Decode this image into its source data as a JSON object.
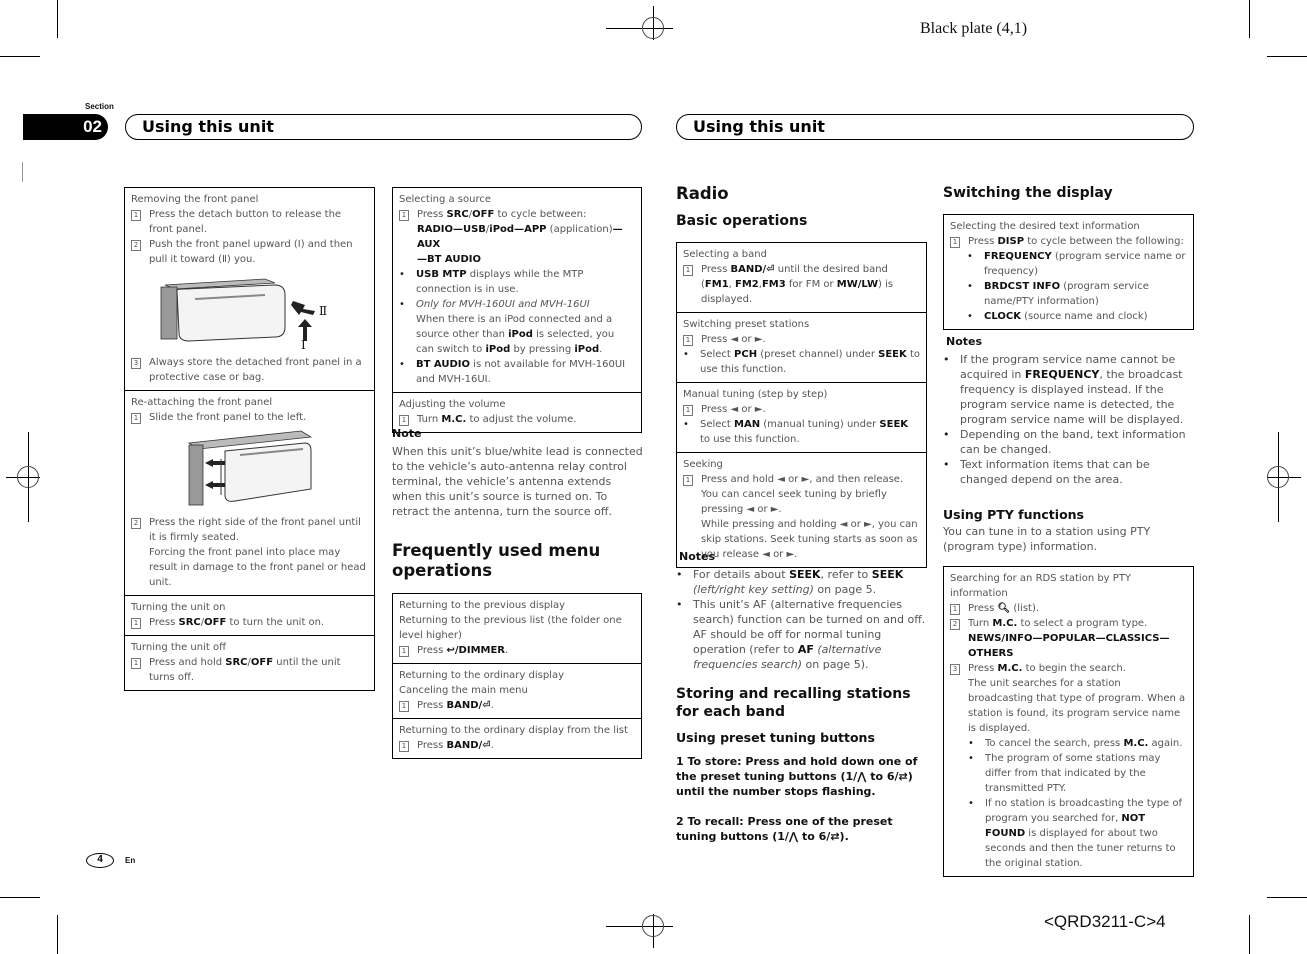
{
  "print_marks": {
    "plate_label": "Black plate (4,1)",
    "doc_code": "<QRD3211-C>4"
  },
  "header": {
    "section_label": "Section",
    "section_number": "02",
    "left_chapter_title": "Using this unit",
    "right_chapter_title": "Using this unit"
  },
  "footer": {
    "page_number": "4",
    "language": "En"
  },
  "col1": {
    "removing": {
      "title": "Removing the front panel",
      "step1": "Press the detach button to release the front panel.",
      "step2": "Push the front panel upward (Ⅰ) and then pull it toward (Ⅱ) you.",
      "step3": "Always store the detached front panel in a protective case or bag.",
      "illus_label_1": "Ⅰ",
      "illus_label_2": "Ⅱ"
    },
    "reattaching": {
      "title": "Re-attaching the front panel",
      "step1": "Slide the front panel to the left.",
      "step2": "Press the right side of the front panel until it is firmly seated.",
      "step2_note": "Forcing the front panel into place may result in damage to the front panel or head unit."
    },
    "turn_on": {
      "title": "Turning the unit on",
      "pre": "Press ",
      "key": "SRC",
      "sep": "/",
      "key2": "OFF",
      "post": " to turn the unit on."
    },
    "turn_off": {
      "title": "Turning the unit off",
      "pre": "Press and hold ",
      "key": "SRC",
      "sep": "/",
      "key2": "OFF",
      "post": " until the unit turns off."
    }
  },
  "col2": {
    "source": {
      "title": "Selecting a source",
      "step_pre": "Press ",
      "step_key": "SRC",
      "step_sep": "/",
      "step_key2": "OFF",
      "step_post": " to cycle between:",
      "cycle_radio": "RADIO",
      "cycle_usb": "USB",
      "cycle_ipod": "iPod",
      "cycle_app": "APP",
      "cycle_app_note": " (application)",
      "cycle_aux": "AUX",
      "cycle_bt": "BT AUDIO",
      "bullet1_key": "USB MTP",
      "bullet1_text": " displays while the MTP connection is in use.",
      "bullet2_italic": "Only for MVH-160UI and MVH-16UI",
      "bullet2_a": "When there is an iPod connected and a source other than ",
      "bullet2_key1": "iPod",
      "bullet2_b": " is selected, you can switch to ",
      "bullet2_key2": "iPod",
      "bullet2_c": " by pressing ",
      "bullet2_key3": "iPod",
      "bullet2_d": ".",
      "bullet3_key": "BT AUDIO",
      "bullet3_text": " is not available for MVH-160UI and MVH-16UI."
    },
    "volume": {
      "title": "Adjusting the volume",
      "pre": "Turn ",
      "key": "M.C.",
      "post": " to adjust the volume."
    },
    "note": {
      "title": "Note",
      "text": "When this unit’s blue/white lead is connected to the vehicle’s auto-antenna relay control terminal, the vehicle’s antenna extends when this unit’s source is turned on. To retract the antenna, turn the source off."
    },
    "menu_heading": "Frequently used menu operations",
    "prev_display": {
      "title": "Returning to the previous display",
      "subtitle": "Returning to the previous list (the folder one level higher)",
      "pre": "Press ",
      "icon": "↩",
      "key": "/DIMMER",
      "post": "."
    },
    "ordinary": {
      "title": "Returning to the ordinary display",
      "subtitle": "Canceling the main menu",
      "pre": "Press ",
      "key": "BAND/",
      "icon": "⏎",
      "post": "."
    },
    "ordinary_list": {
      "title": "Returning to the ordinary display from the list",
      "pre": "Press ",
      "key": "BAND/",
      "icon": "⏎",
      "post": "."
    }
  },
  "col3": {
    "radio_heading": "Radio",
    "basic_heading": "Basic operations",
    "band": {
      "title": "Selecting a band",
      "pre": "Press ",
      "key": "BAND/",
      "icon": "⏎",
      "mid": " until the desired band (",
      "fm1": "FM1",
      "c1": ", ",
      "fm2": "FM2",
      "c2": ",",
      "fm3": "FM3",
      "mid2": " for FM or ",
      "mwlw": "MW/LW",
      "post": ") is displayed."
    },
    "preset": {
      "title": "Switching preset stations",
      "step": "Press ◄ or ►.",
      "b_pre": "Select ",
      "b_key": "PCH",
      "b_mid": " (preset channel) under ",
      "b_key2": "SEEK",
      "b_post": " to use this function."
    },
    "manual": {
      "title": "Manual tuning (step by step)",
      "step": "Press ◄ or ►.",
      "b_pre": "Select ",
      "b_key": "MAN",
      "b_mid": " (manual tuning) under ",
      "b_key2": "SEEK",
      "b_post": " to use this function."
    },
    "seeking": {
      "title": "Seeking",
      "step": "Press and hold ◄ or ►, and then release.",
      "line2": "You can cancel seek tuning by briefly pressing ◄ or ►.",
      "line3": "While pressing and holding ◄ or ►, you can skip stations. Seek tuning starts as soon as you release ◄ or ►."
    },
    "notes": {
      "title": "Notes",
      "n1_pre": "For details about ",
      "n1_key": "SEEK",
      "n1_mid": ", refer to ",
      "n1_key2": "SEEK",
      "n1_italic": " (left/right key setting)",
      "n1_post": " on page 5.",
      "n2_pre": "This unit’s AF (alternative frequencies search) function can be turned on and off. AF should be off for normal tuning operation (refer to ",
      "n2_key": "AF",
      "n2_italic": " (alternative frequencies search)",
      "n2_post": " on page 5)."
    },
    "storing_heading": "Storing and recalling stations for each band",
    "preset_heading": "Using preset tuning buttons",
    "step1": "1    To store: Press and hold down one of the preset tuning buttons (1/⋀ to 6/⇄) until the number stops flashing.",
    "step2": "2    To recall: Press one of the preset tuning buttons (1/⋀ to 6/⇄)."
  },
  "col4": {
    "display_heading": "Switching the display",
    "text_info": {
      "title": "Selecting the desired text information",
      "pre": "Press ",
      "key": "DISP",
      "post": " to cycle between the following:",
      "opt1_key": "FREQUENCY",
      "opt1_text": " (program service name or frequency)",
      "opt2_key": "BRDCST INFO",
      "opt2_text": " (program service name/PTY information)",
      "opt3_key": "CLOCK",
      "opt3_text": " (source name and clock)"
    },
    "notes": {
      "title": "Notes",
      "n1_pre": "If the program service name cannot be acquired in ",
      "n1_key": "FREQUENCY",
      "n1_post": ", the broadcast frequency is displayed instead. If the program service name is detected, the program service name will be displayed.",
      "n2": "Depending on the band, text information can be changed.",
      "n3": "Text information items that can be changed depend on the area."
    },
    "pty_heading": "Using PTY functions",
    "pty_intro": "You can tune in to a station using PTY (program type) information.",
    "pty_search": {
      "title": "Searching for an RDS station by PTY information",
      "s1_pre": "Press ",
      "s1_post": " (list).",
      "s2_pre": "Turn ",
      "s2_key": "M.C.",
      "s2_post": " to select a program type.",
      "types": "NEWS/INFO—POPULAR—CLASSICS—OTHERS",
      "s3_pre": "Press ",
      "s3_key": "M.C.",
      "s3_post": " to begin the search.",
      "s3_desc": "The unit searches for a station broadcasting that type of program. When a station is found, its program service name is displayed.",
      "b1_pre": "To cancel the search, press ",
      "b1_key": "M.C.",
      "b1_post": " again.",
      "b2": "The program of some stations may differ from that indicated by the transmitted PTY.",
      "b3_pre": "If no station is broadcasting the type of program you searched for, ",
      "b3_key": "NOT FOUND",
      "b3_post": " is displayed for about two seconds and then the tuner returns to the original station."
    }
  }
}
